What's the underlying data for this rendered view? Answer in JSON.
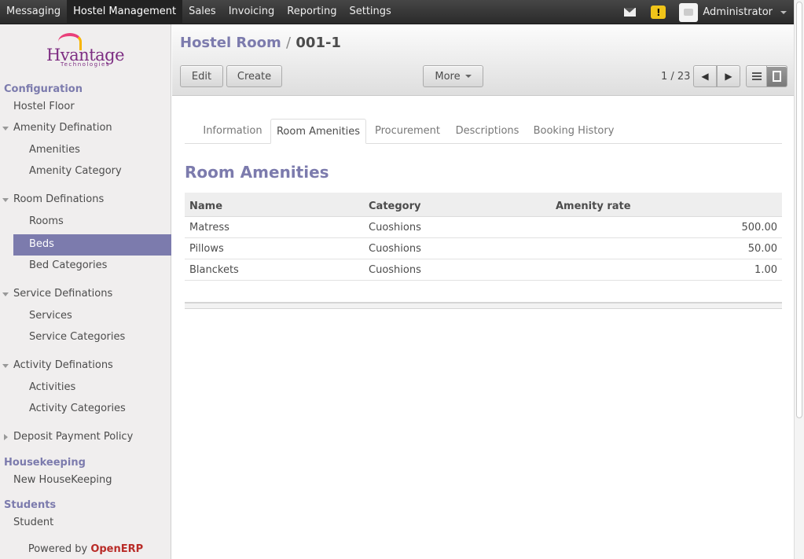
{
  "topbar": {
    "menu": [
      "Messaging",
      "Hostel Management",
      "Sales",
      "Invoicing",
      "Reporting",
      "Settings"
    ],
    "active_index": 1,
    "user": "Administrator"
  },
  "sidebar": {
    "logo_text": "Hvantage",
    "logo_sub": "Technologies",
    "sections": [
      {
        "title": "Configuration"
      },
      {
        "title": "Housekeeping"
      },
      {
        "title": "Students"
      }
    ],
    "items": {
      "hostel_floor": "Hostel Floor",
      "amenity_defination": "Amenity Defination",
      "amenities": "Amenities",
      "amenity_category": "Amenity Category",
      "room_definations": "Room Definations",
      "rooms": "Rooms",
      "beds": "Beds",
      "bed_categories": "Bed Categories",
      "service_definations": "Service Definations",
      "services": "Services",
      "service_categories": "Service Categories",
      "activity_definations": "Activity Definations",
      "activities": "Activities",
      "activity_categories": "Activity Categories",
      "deposit_payment_policy": "Deposit Payment Policy",
      "new_housekeeping": "New HouseKeeping",
      "student": "Student"
    },
    "powered_by": "Powered by",
    "powered_brand": "OpenERP"
  },
  "header": {
    "crumb_parent": "Hostel Room",
    "crumb_sep": "/",
    "crumb_current": "001-1",
    "edit_label": "Edit",
    "create_label": "Create",
    "more_label": "More",
    "pager": "1 / 23"
  },
  "tabs": [
    "Information",
    "Room Amenities",
    "Procurement",
    "Descriptions",
    "Booking History"
  ],
  "active_tab": 1,
  "section_title": "Room Amenities",
  "table": {
    "columns": [
      "Name",
      "Category",
      "Amenity rate"
    ],
    "rows": [
      {
        "name": "Matress",
        "category": "Cuoshions",
        "rate": "500.00"
      },
      {
        "name": "Pillows",
        "category": "Cuoshions",
        "rate": "50.00"
      },
      {
        "name": "Blanckets",
        "category": "Cuoshions",
        "rate": "1.00"
      }
    ]
  },
  "colors": {
    "accent": "#7c7bad",
    "brand_red": "#b92c28",
    "topbar": "#2a2a2a"
  }
}
